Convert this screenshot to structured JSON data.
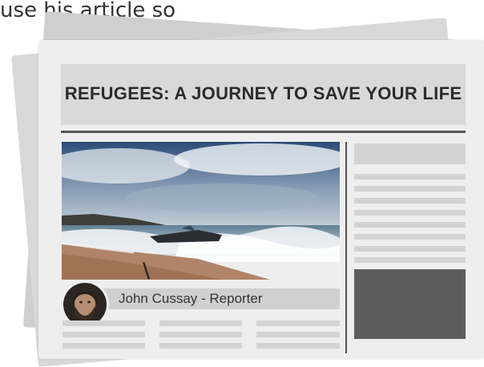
{
  "intro_text": "use his article so",
  "newspaper": {
    "headline": "REFUGEES: A JOURNEY TO SAVE YOUR LIFE",
    "photo_caption": "John Cussay - Reporter"
  }
}
